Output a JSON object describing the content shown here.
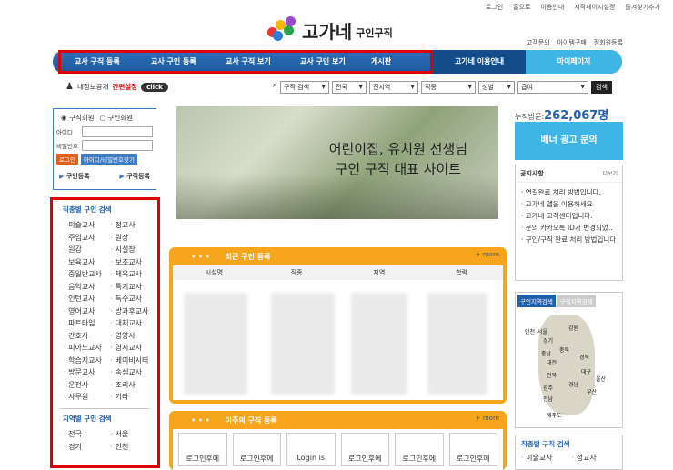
{
  "top_links": [
    "로그인",
    "홈으로",
    "이용안내",
    "시작페이지설정",
    "즐겨찾기추가"
  ],
  "logo": {
    "main": "고가네",
    "sub": "구인구직"
  },
  "nav_sub": [
    "고객문의",
    "아이템구매",
    "정회원등록"
  ],
  "nav": {
    "items": [
      "교사 구직 등록",
      "교사 구인 등록",
      "교사 구직 보기",
      "교사 구인 보기",
      "게시판"
    ],
    "guide": "고가네 이용안내",
    "mypage": "마이페이지"
  },
  "notice_setting": {
    "label": "내정보공개",
    "red": "간편설정",
    "click": "click"
  },
  "search": {
    "selects": [
      "구직 검색",
      "전국",
      "전지역",
      "직종",
      "성별",
      "급여"
    ],
    "button": "검색"
  },
  "login": {
    "member1": "구직회원",
    "member2": "구인회원",
    "id_label": "아이디",
    "pw_label": "비밀번호",
    "login_btn": "로그인",
    "find_btn": "아이디/비밀번호찾기",
    "reg1": "구인등록",
    "reg2": "구직등록"
  },
  "job_search": {
    "title": "직종별 구인 검색",
    "items": [
      "미술교사",
      "정교사",
      "주임교사",
      "원장",
      "원감",
      "시설장",
      "보육교사",
      "보조교사",
      "중일반교사",
      "체육교사",
      "음악교사",
      "특기교사",
      "인턴교사",
      "특수교사",
      "영어교사",
      "방과후교사",
      "파트타임",
      "대체교사",
      "간호사",
      "영양사",
      "피아노교사",
      "영시교사",
      "학습지교사",
      "베이비시터",
      "방문교사",
      "속셈교사",
      "운전사",
      "조리사",
      "사무원",
      "기타"
    ]
  },
  "region_search": {
    "title": "지역별 구인 검색",
    "items": [
      "전국",
      "서울",
      "경기",
      "인천"
    ]
  },
  "banner": {
    "line1": "어린이집, 유치원 선생님",
    "line2": "구인 구직 대표 사이트"
  },
  "visit": {
    "label": "누적방문:",
    "count": "262,067명"
  },
  "ad": "배너 광고 문의",
  "notice": {
    "title": "공지사항",
    "more": "더보기",
    "items": [
      "연길완료 처리 방법입니다.",
      "고가네 앱을 이용하세요",
      "고가네 고객센터입니다.",
      "문의 카카오톡 ID가 변경되었..",
      "구인/구직 완료 처리 방법입니다"
    ]
  },
  "region": {
    "tab1": "구인지역검색",
    "tab2": "구직지역검색",
    "labels": [
      "서울",
      "인천",
      "강원",
      "경기",
      "충남",
      "충북",
      "대전",
      "경북",
      "전북",
      "대구",
      "울산",
      "광주",
      "경남",
      "부산",
      "전남",
      "제주도"
    ]
  },
  "rjobs": {
    "title": "직종별 구직 검색",
    "items": [
      "미술교사",
      "정교사"
    ]
  },
  "recent": {
    "title": "최근 구인 등록",
    "more": "+ more",
    "headers": [
      "시설명",
      "직종",
      "지역",
      "학력"
    ]
  },
  "week": {
    "title": "이주의 구직 등록",
    "more": "+ more",
    "cards": [
      "로그인후에",
      "로그인후에",
      "Login is",
      "로그인후에",
      "로그인후에",
      "로그인후에"
    ]
  }
}
